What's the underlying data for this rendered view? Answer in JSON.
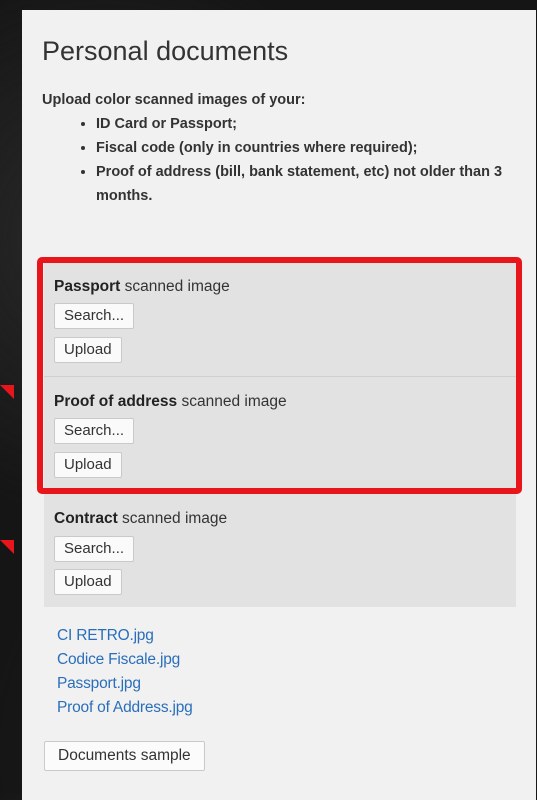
{
  "page": {
    "title": "Personal documents",
    "intro": "Upload color scanned images of your:",
    "requirements": [
      "ID Card or Passport;",
      "Fiscal code (only in countries where required);",
      "Proof of address (bill, bank statement, etc) not older than 3 months."
    ]
  },
  "uploads": [
    {
      "name": "Passport",
      "suffix": " scanned image",
      "search_label": "Search...",
      "upload_label": "Upload"
    },
    {
      "name": "Proof of address",
      "suffix": " scanned image",
      "search_label": "Search...",
      "upload_label": "Upload"
    },
    {
      "name": "Contract",
      "suffix": " scanned image",
      "search_label": "Search...",
      "upload_label": "Upload"
    }
  ],
  "files": [
    "CI RETRO.jpg",
    "Codice Fiscale.jpg",
    "Passport.jpg",
    "Proof of Address.jpg"
  ],
  "sample_button": "Documents sample",
  "colors": {
    "highlight": "#e8161a",
    "link": "#2a6ebb",
    "section_bg": "#e2e2e2",
    "panel_bg": "#f1f1f1"
  }
}
